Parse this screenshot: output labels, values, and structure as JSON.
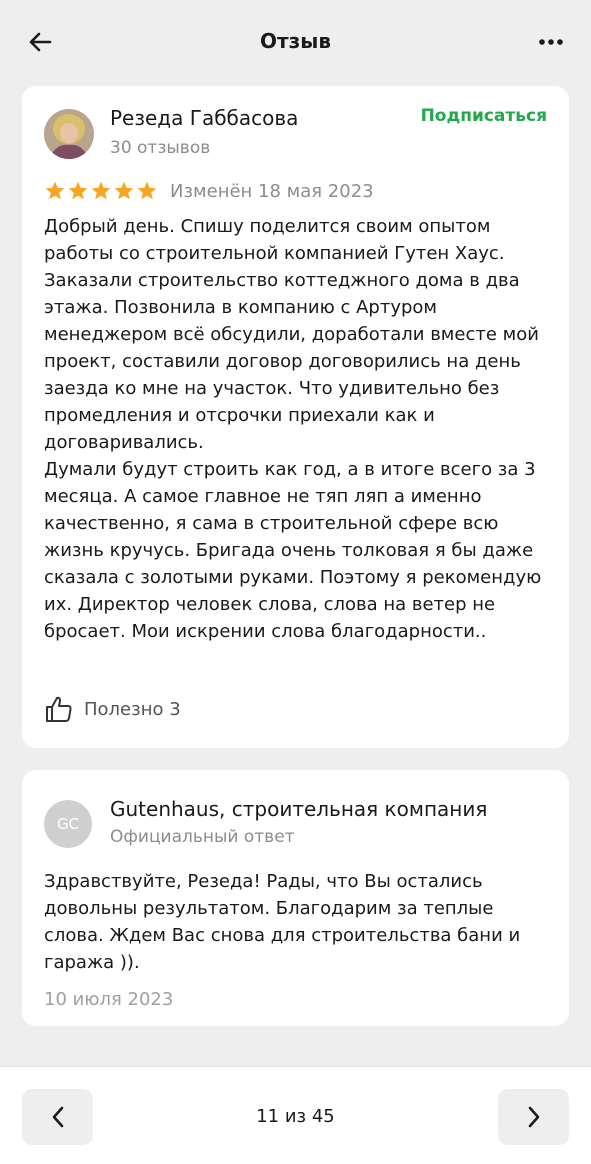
{
  "header": {
    "title": "Отзыв",
    "back_icon": "arrow-left-icon",
    "more_icon": "more-horizontal-icon"
  },
  "review": {
    "author": "Резеда Габбасова",
    "reviews_count": "30 отзывов",
    "subscribe_label": "Подписаться",
    "rating": 5,
    "rating_max": 5,
    "edited": "Изменён 18 мая 2023",
    "text": "Добрый день. Спишу поделится своим опытом работы со строительной компанией Гутен Хаус. Заказали строительство коттеджного дома в два этажа. Позвонила в компанию с Артуром менеджером всё обсудили, доработали вместе мой проект, составили договор договорились на день заезда ко мне на участок. Что удивительно без промедления и отсрочки приехали как и договаривались.\nДумали будут строить как год, а в итоге всего за 3 месяца. А самое главное не тяп ляп а именно качественно, я сама в строительной сфере всю жизнь кручусь. Бригада очень толковая я бы даже сказала с золотыми руками. Поэтому я рекомендую их. Директор человек слова, слова на ветер не бросает. Мои искрении слова благодарности..",
    "useful_label": "Полезно 3",
    "colors": {
      "star": "#f5a623",
      "subscribe": "#23a84a"
    }
  },
  "reply": {
    "avatar_initials": "GC",
    "company": "Gutenhaus, строительная компания",
    "label": "Официальный ответ",
    "text": "Здравствуйте, Резеда! Рады, что Вы остались довольны результатом. Благодарим за теплые слова. Ждем Вас снова для строительства бани и гаража )).",
    "date": "10 июля 2023"
  },
  "pagination": {
    "text": "11 из 45",
    "prev_icon": "chevron-left-icon",
    "next_icon": "chevron-right-icon"
  }
}
